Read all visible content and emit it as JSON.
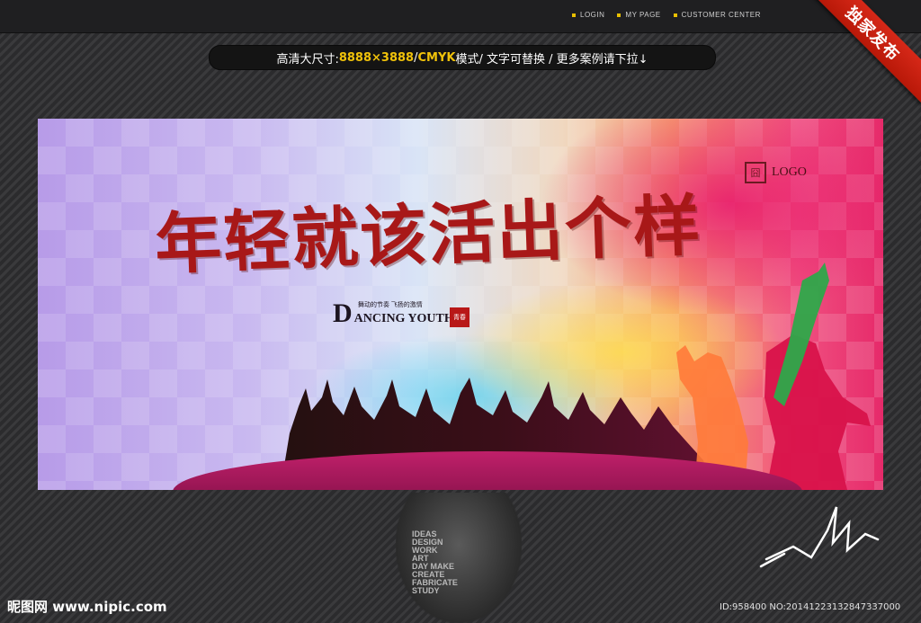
{
  "nav": {
    "items": [
      {
        "label": "LOGIN"
      },
      {
        "label": "MY PAGE"
      },
      {
        "label": "CUSTOMER CENTER"
      }
    ],
    "accent_color": "#e9c000"
  },
  "ribbon": {
    "label": "独家发布",
    "color": "#d62818"
  },
  "info_bar": {
    "prefix": "高清大尺寸:",
    "size": "8888×3888",
    "sep1": " / ",
    "mode": "CMYK",
    "mode_suffix": "模式",
    "rest": " / 文字可替换 / 更多案例请下拉↓"
  },
  "banner": {
    "title": "年轻就该活出个样",
    "logo_text": "LOGO",
    "logo_mark": "囧",
    "dancing_big": "D",
    "dancing_rest": "ANCING YOUTH",
    "tagline": "舞动的节奏 飞扬的激情",
    "seal_text": "青春",
    "colors": {
      "title": "#a81818",
      "magenta": "#e8186c",
      "yellow": "#ffe04a",
      "cyan": "#4ed0f0"
    }
  },
  "face_words": [
    "IDEAS",
    "DESIGN",
    "WORK",
    "ART",
    "DAY MAKE",
    "CREATE",
    "FABRICATE",
    "STUDY"
  ],
  "footer": {
    "site": "昵图网 www.nipic.com",
    "id": "ID:958400 NO:20141223132847337000"
  }
}
